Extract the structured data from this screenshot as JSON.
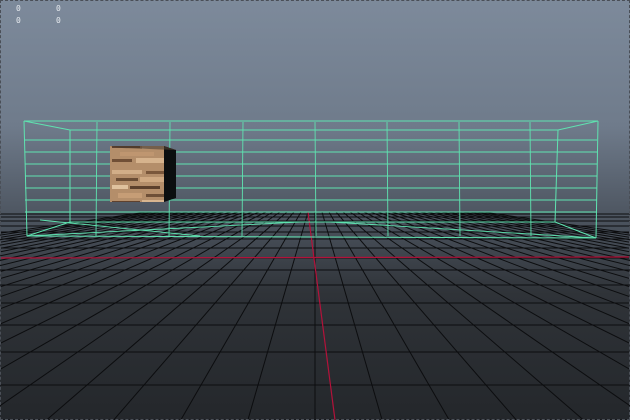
{
  "hud": {
    "values": [
      "0",
      "0",
      "0",
      "0"
    ]
  },
  "colors": {
    "wireframe": "#5fe3b0",
    "grid": "#0c0d0f",
    "axis_x": "#b3123a",
    "axis_z": "#b3123a",
    "texture_light": "#c9a27c",
    "texture_dark": "#6b4d35",
    "texture_side": "#0a0c0d"
  },
  "objects": {
    "wireframe_box": "selected-mesh",
    "textured_cube": "cube-mesh"
  }
}
